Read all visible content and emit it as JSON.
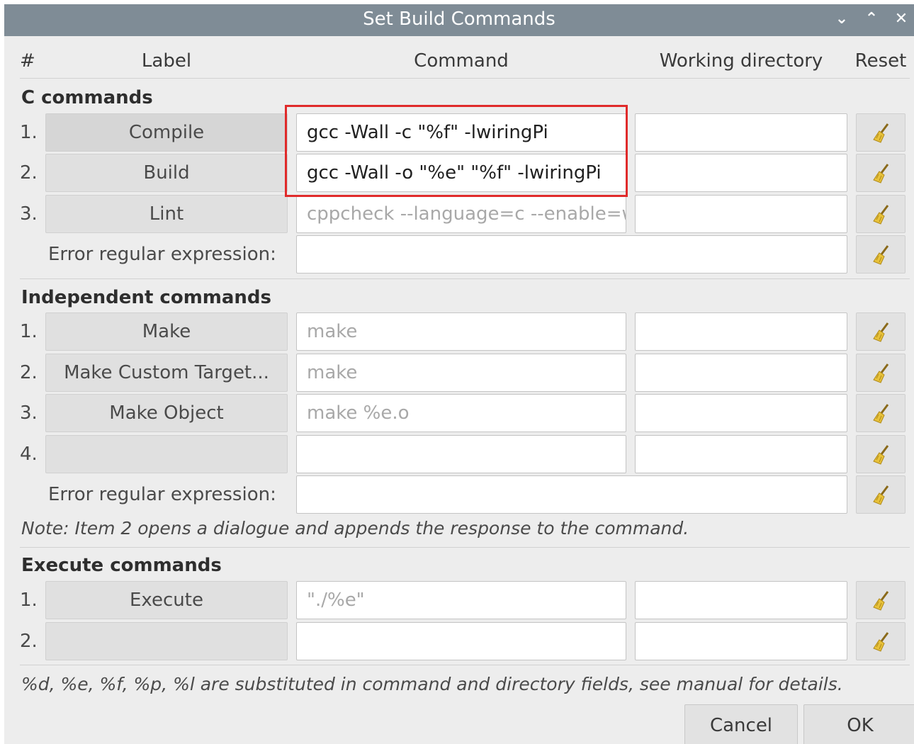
{
  "window": {
    "title": "Set Build Commands",
    "controls": {
      "minimize": "⌄",
      "maximize": "⌃",
      "close": "✕"
    }
  },
  "headers": {
    "num": "#",
    "label": "Label",
    "command": "Command",
    "working_directory": "Working directory",
    "reset": "Reset"
  },
  "c_commands": {
    "title": "C commands",
    "rows": [
      {
        "num": "1.",
        "label": "Compile",
        "command": "gcc -Wall -c \"%f\" -lwiringPi",
        "directory": ""
      },
      {
        "num": "2.",
        "label": "Build",
        "command": "gcc -Wall -o \"%e\" \"%f\" -lwiringPi",
        "directory": ""
      },
      {
        "num": "3.",
        "label": "Lint",
        "command": "cppcheck --language=c --enable=w",
        "directory": ""
      }
    ],
    "error_label": "Error regular expression:",
    "error_value": ""
  },
  "independent_commands": {
    "title": "Independent commands",
    "rows": [
      {
        "num": "1.",
        "label": "Make",
        "command": "make",
        "directory": ""
      },
      {
        "num": "2.",
        "label": "Make Custom Target...",
        "command": "make",
        "directory": ""
      },
      {
        "num": "3.",
        "label": "Make Object",
        "command": "make %e.o",
        "directory": ""
      },
      {
        "num": "4.",
        "label": "",
        "command": "",
        "directory": ""
      }
    ],
    "error_label": "Error regular expression:",
    "error_value": "",
    "note": "Note: Item 2 opens a dialogue and appends the response to the command."
  },
  "execute_commands": {
    "title": "Execute commands",
    "rows": [
      {
        "num": "1.",
        "label": "Execute",
        "command": "\"./%e\"",
        "directory": ""
      },
      {
        "num": "2.",
        "label": "",
        "command": "",
        "directory": ""
      }
    ]
  },
  "footer_note": "%d, %e, %f, %p, %l are substituted in command and directory fields, see manual for details.",
  "buttons": {
    "cancel": "Cancel",
    "ok": "OK"
  },
  "colors": {
    "titlebar": "#7f8c96",
    "highlight": "#e02a2a",
    "broom_head": "#e8c23a",
    "broom_handle": "#8a6a1a"
  }
}
